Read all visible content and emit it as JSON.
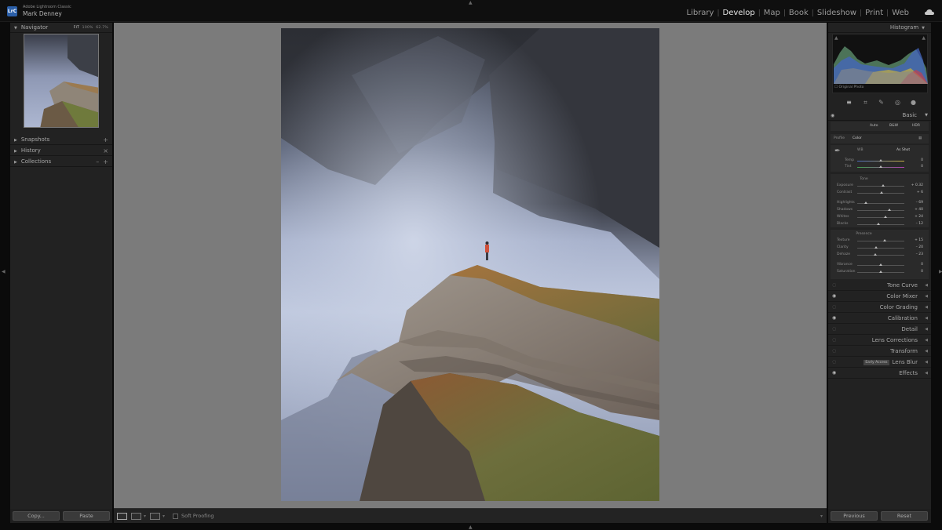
{
  "app": {
    "logo_text": "LrC",
    "title": "Adobe Lightroom Classic",
    "user": "Mark Denney"
  },
  "modules": [
    {
      "label": "Library",
      "active": false
    },
    {
      "label": "Develop",
      "active": true
    },
    {
      "label": "Map",
      "active": false
    },
    {
      "label": "Book",
      "active": false
    },
    {
      "label": "Slideshow",
      "active": false
    },
    {
      "label": "Print",
      "active": false
    },
    {
      "label": "Web",
      "active": false
    }
  ],
  "left_panel": {
    "navigator": {
      "title": "Navigator",
      "zoom_fit": "FIT",
      "zoom_fill": "100%",
      "zoom_other": "62.7%"
    },
    "snapshots": "Snapshots",
    "history": "History",
    "collections": "Collections",
    "copy_btn": "Copy...",
    "paste_btn": "Paste"
  },
  "toolbar": {
    "soft_proofing": "Soft Proofing"
  },
  "right_panel": {
    "histogram": "Histogram",
    "original_photo": "Original Photo",
    "basic": {
      "title": "Basic",
      "auto": "Auto",
      "bw": "B&W",
      "hdr": "HDR",
      "profile_label": "Profile",
      "profile_value": "Color",
      "wb_label": "WB",
      "wb_value": "As Shot",
      "temp": "Temp",
      "tint": "Tint",
      "temp_val": "0",
      "tint_val": "0",
      "tone_label": "Tone",
      "sliders": [
        {
          "label": "Exposure",
          "value": "+ 0.32",
          "pos": 0.55
        },
        {
          "label": "Contrast",
          "value": "+ 6",
          "pos": 0.52
        },
        {
          "label": "Highlights",
          "value": "– 69",
          "pos": 0.18
        },
        {
          "label": "Shadows",
          "value": "+ 40",
          "pos": 0.68
        },
        {
          "label": "Whites",
          "value": "+ 24",
          "pos": 0.6
        },
        {
          "label": "Blacks",
          "value": "– 12",
          "pos": 0.45
        }
      ],
      "presence_label": "Presence",
      "presence": [
        {
          "label": "Texture",
          "value": "+ 15",
          "pos": 0.58
        },
        {
          "label": "Clarity",
          "value": "– 20",
          "pos": 0.4
        },
        {
          "label": "Dehaze",
          "value": "– 23",
          "pos": 0.39
        }
      ],
      "color": [
        {
          "label": "Vibrance",
          "value": "0",
          "pos": 0.5
        },
        {
          "label": "Saturation",
          "value": "0",
          "pos": 0.5
        }
      ]
    },
    "sections": [
      {
        "label": "Tone Curve",
        "eye": false
      },
      {
        "label": "Color Mixer",
        "eye": true
      },
      {
        "label": "Color Grading",
        "eye": false
      },
      {
        "label": "Calibration",
        "eye": true
      },
      {
        "label": "Detail",
        "eye": false
      },
      {
        "label": "Lens Corrections",
        "eye": false
      },
      {
        "label": "Transform",
        "eye": false
      },
      {
        "label": "Lens Blur",
        "eye": false,
        "badge": "Early Access"
      },
      {
        "label": "Effects",
        "eye": true
      }
    ],
    "previous_btn": "Previous",
    "reset_btn": "Reset"
  },
  "colors": {
    "accent": "#2b5fa8",
    "panel": "#222222",
    "canvas": "#7b7b7b"
  }
}
